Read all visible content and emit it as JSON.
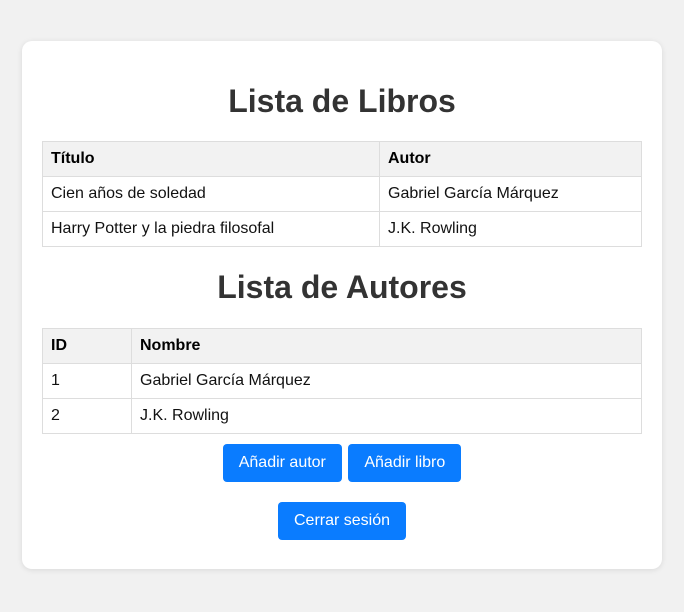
{
  "books_section": {
    "title": "Lista de Libros",
    "headers": [
      "Título",
      "Autor"
    ],
    "rows": [
      [
        "Cien años de soledad",
        "Gabriel García Márquez"
      ],
      [
        "Harry Potter y la piedra filosofal",
        "J.K. Rowling"
      ]
    ]
  },
  "authors_section": {
    "title": "Lista de Autores",
    "headers": [
      "ID",
      "Nombre"
    ],
    "rows": [
      [
        "1",
        "Gabriel García Márquez"
      ],
      [
        "2",
        "J.K. Rowling"
      ]
    ]
  },
  "actions": {
    "add_author": "Añadir autor",
    "add_book": "Añadir libro",
    "logout": "Cerrar sesión"
  },
  "colors": {
    "button": "#0a7cff",
    "page_background": "#f1f1f1",
    "card_background": "#ffffff",
    "header_background": "#f2f2f2"
  }
}
